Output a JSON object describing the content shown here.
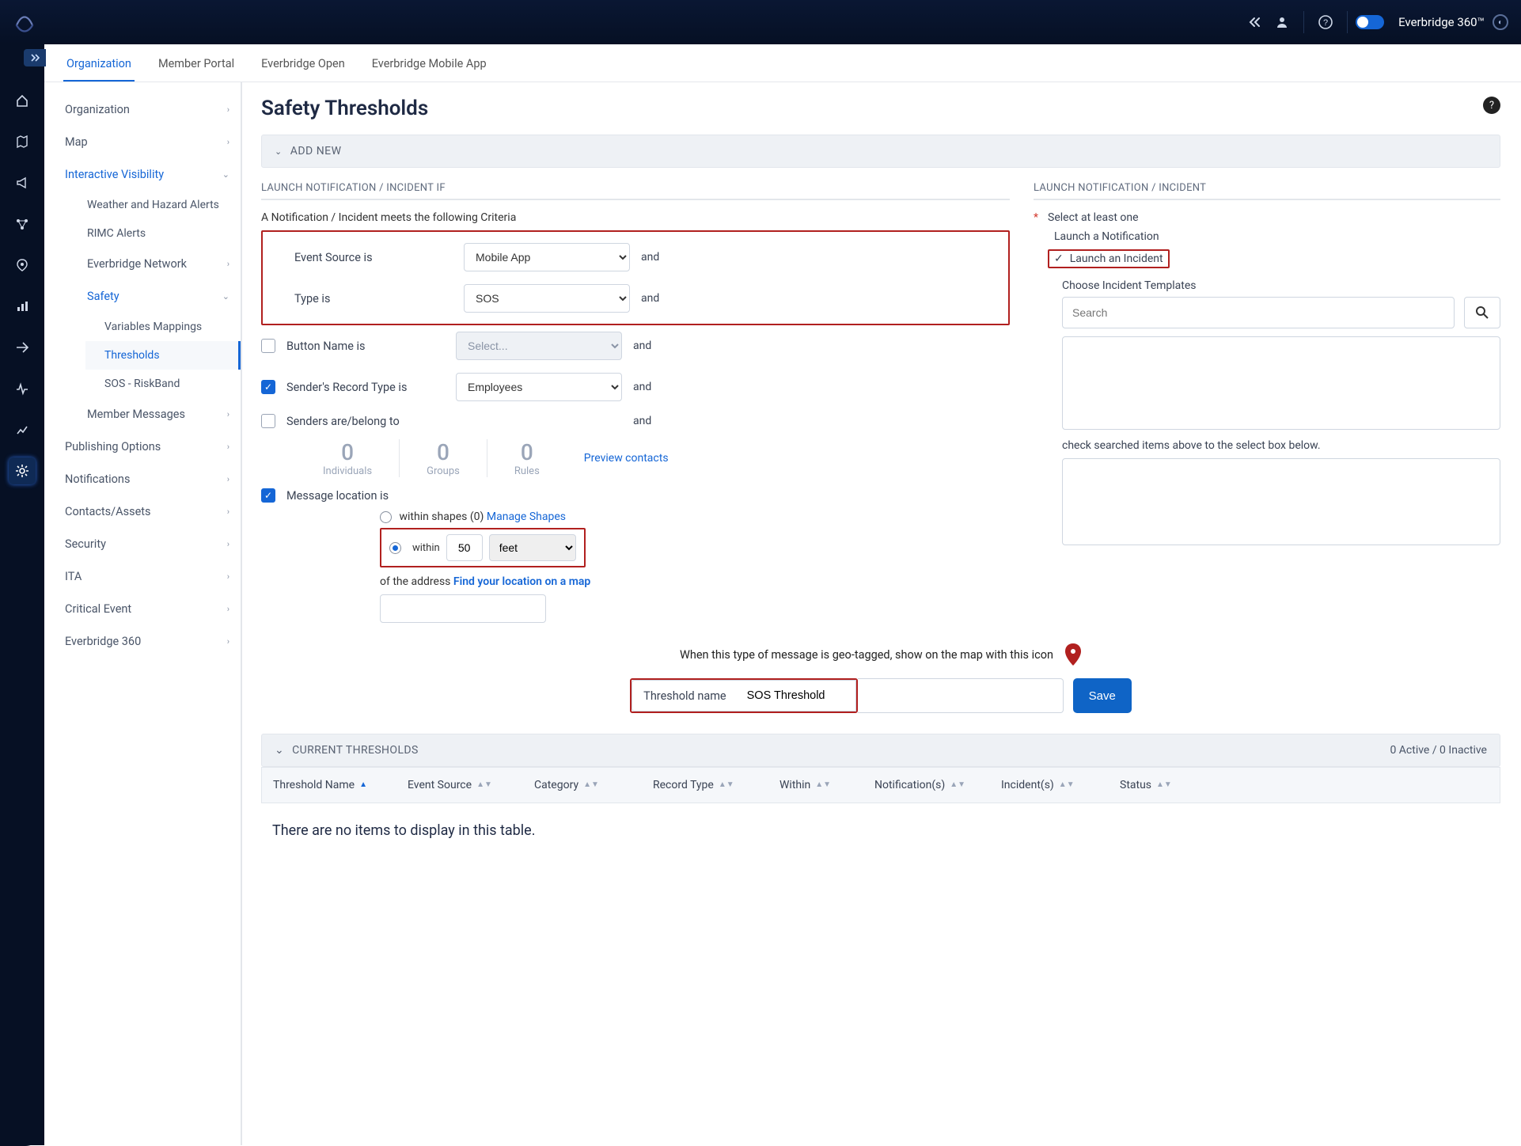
{
  "brand": {
    "name": "Everbridge 360™"
  },
  "tabs": [
    "Organization",
    "Member Portal",
    "Everbridge Open",
    "Everbridge Mobile App"
  ],
  "active_tab": "Organization",
  "sidenav": {
    "items": [
      {
        "label": "Organization",
        "expandable": true
      },
      {
        "label": "Map",
        "expandable": true
      },
      {
        "label": "Interactive Visibility",
        "expandable": true,
        "open": true,
        "children": [
          {
            "label": "Weather and Hazard Alerts"
          },
          {
            "label": "RIMC Alerts"
          },
          {
            "label": "Everbridge Network",
            "expandable": true
          },
          {
            "label": "Safety",
            "expandable": true,
            "open": true,
            "children": [
              {
                "label": "Variables Mappings"
              },
              {
                "label": "Thresholds",
                "selected": true
              },
              {
                "label": "SOS - RiskBand"
              }
            ]
          },
          {
            "label": "Member Messages",
            "expandable": true
          }
        ]
      },
      {
        "label": "Publishing Options",
        "expandable": true
      },
      {
        "label": "Notifications",
        "expandable": true
      },
      {
        "label": "Contacts/Assets",
        "expandable": true
      },
      {
        "label": "Security",
        "expandable": true
      },
      {
        "label": "ITA",
        "expandable": true
      },
      {
        "label": "Critical Event",
        "expandable": true
      },
      {
        "label": "Everbridge 360",
        "expandable": true
      }
    ]
  },
  "page": {
    "title": "Safety Thresholds",
    "add_new": "ADD NEW",
    "left_section": "LAUNCH NOTIFICATION / INCIDENT IF",
    "criteria_note": "A Notification / Incident meets the following Criteria",
    "rows": {
      "event_source": {
        "label": "Event Source is",
        "value": "Mobile App",
        "and": "and"
      },
      "type": {
        "label": "Type is",
        "value": "SOS",
        "and": "and"
      },
      "button_name": {
        "label": "Button Name is",
        "value": "Select...",
        "and": "and"
      },
      "record_type": {
        "label": "Sender's Record Type is",
        "value": "Employees",
        "and": "and"
      },
      "senders": {
        "label": "Senders are/belong to",
        "and": "and"
      },
      "msg_loc": {
        "label": "Message location is"
      }
    },
    "counts": {
      "individuals": {
        "n": "0",
        "t": "Individuals"
      },
      "groups": {
        "n": "0",
        "t": "Groups"
      },
      "rules": {
        "n": "0",
        "t": "Rules"
      }
    },
    "preview": "Preview contacts",
    "shapes": {
      "line": "within shapes (0)",
      "link": "Manage Shapes"
    },
    "within": {
      "label": "within",
      "value": "50",
      "unit": "feet"
    },
    "addr": {
      "prefix": "of the address",
      "link": "Find your location on a map"
    },
    "right_section": "LAUNCH NOTIFICATION / INCIDENT",
    "select_one": "Select at least one",
    "launch_notif": "Launch a Notification",
    "launch_inc": "Launch an Incident",
    "choose_tpl": "Choose Incident Templates",
    "search_ph": "Search",
    "hint": "check searched items above to the select box below.",
    "geo_note": "When this type of message is geo-tagged, show on the map with this icon",
    "tn_label": "Threshold name",
    "tn_value": "SOS Threshold",
    "save": "Save",
    "current": "CURRENT THRESHOLDS",
    "current_right": "0 Active / 0 Inactive",
    "columns": [
      "Threshold Name",
      "Event Source",
      "Category",
      "Record Type",
      "Within",
      "Notification(s)",
      "Incident(s)",
      "Status"
    ],
    "empty": "There are no items to display in this table."
  }
}
